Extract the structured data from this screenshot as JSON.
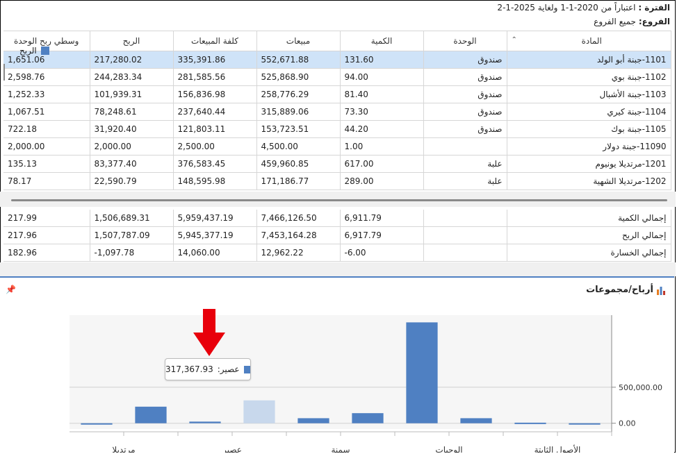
{
  "info": {
    "period_label": "الفترة :",
    "period_value": "اعتباراً من 2020-1-1 ولغاية 2025-1-2",
    "branches_label": "الفروع:",
    "branches_value": "جميع الفروع"
  },
  "columns": [
    "المادة",
    "الوحدة",
    "الكمية",
    "مبيعات",
    "كلفة المبيعات",
    "الربح",
    "وسطي ربح الوحدة"
  ],
  "rows": [
    {
      "item": "1101-جبنة أبو الولد",
      "unit": "صندوق",
      "qty": "131.60",
      "sales": "552,671.88",
      "cost": "335,391.86",
      "profit": "217,280.02",
      "avg": "1,651.06",
      "selected": true
    },
    {
      "item": "1102-جبنة بوي",
      "unit": "صندوق",
      "qty": "94.00",
      "sales": "525,868.90",
      "cost": "281,585.56",
      "profit": "244,283.34",
      "avg": "2,598.76"
    },
    {
      "item": "1103-جبنة الأشبال",
      "unit": "صندوق",
      "qty": "81.40",
      "sales": "258,776.29",
      "cost": "156,836.98",
      "profit": "101,939.31",
      "avg": "1,252.33"
    },
    {
      "item": "1104-جبنة كيري",
      "unit": "صندوق",
      "qty": "73.30",
      "sales": "315,889.06",
      "cost": "237,640.44",
      "profit": "78,248.61",
      "avg": "1,067.51"
    },
    {
      "item": "1105-جبنة بوك",
      "unit": "صندوق",
      "qty": "44.20",
      "sales": "153,723.51",
      "cost": "121,803.11",
      "profit": "31,920.40",
      "avg": "722.18"
    },
    {
      "item": "11090-جبنة دولار",
      "unit": "",
      "qty": "1.00",
      "sales": "4,500.00",
      "cost": "2,500.00",
      "profit": "2,000.00",
      "avg": "2,000.00"
    },
    {
      "item": "1201-مرتديلا يونيوم",
      "unit": "علبة",
      "qty": "617.00",
      "sales": "459,960.85",
      "cost": "376,583.45",
      "profit": "83,377.40",
      "avg": "135.13"
    },
    {
      "item": "1202-مرتديلا الشهية",
      "unit": "علبة",
      "qty": "289.00",
      "sales": "171,186.77",
      "cost": "148,595.98",
      "profit": "22,590.79",
      "avg": "78.17"
    }
  ],
  "totals": [
    {
      "label": "إجمالي الكمية",
      "qty": "6,911.79",
      "sales": "7,466,126.50",
      "cost": "5,959,437.19",
      "profit": "1,506,689.31",
      "avg": "217.99"
    },
    {
      "label": "إجمالي الربح",
      "qty": "6,917.79",
      "sales": "7,453,164.28",
      "cost": "5,945,377.19",
      "profit": "1,507,787.09",
      "avg": "217.96"
    },
    {
      "label": "إجمالي الخسارة",
      "qty": "-6.00",
      "sales": "12,962.22",
      "cost": "14,060.00",
      "profit": "-1,097.78",
      "avg": "182.96"
    }
  ],
  "chart_panel": {
    "title": "أرباح/مجموعات",
    "legend": "الربح",
    "tooltip_label": "عصير:",
    "tooltip_value": "317,367.93"
  },
  "chart_data": {
    "type": "bar",
    "categories": [
      "c1",
      "c2",
      "c3",
      "c4",
      "c5",
      "c6",
      "c7",
      "c8",
      "c9",
      "c10"
    ],
    "category_labels": [
      "الأصول الثابتة",
      "",
      "الوجبات",
      "",
      "سمنة",
      "",
      "عصير",
      "",
      "مرتديلا",
      ""
    ],
    "series": [
      {
        "name": "الربح",
        "values": [
          -2000,
          8000,
          70000,
          1400000,
          140000,
          70000,
          317367.93,
          22590.79,
          230000,
          -5000
        ]
      }
    ],
    "highlight_index": 6,
    "ylim": [
      -80000,
      1500000
    ],
    "yticks": [
      "0.00",
      "500,000.00"
    ],
    "ytick_values": [
      0,
      500000
    ],
    "colors": {
      "bar": "#4f80c2",
      "highlight": "#c8d8ec",
      "arrow": "#e8000b"
    }
  }
}
